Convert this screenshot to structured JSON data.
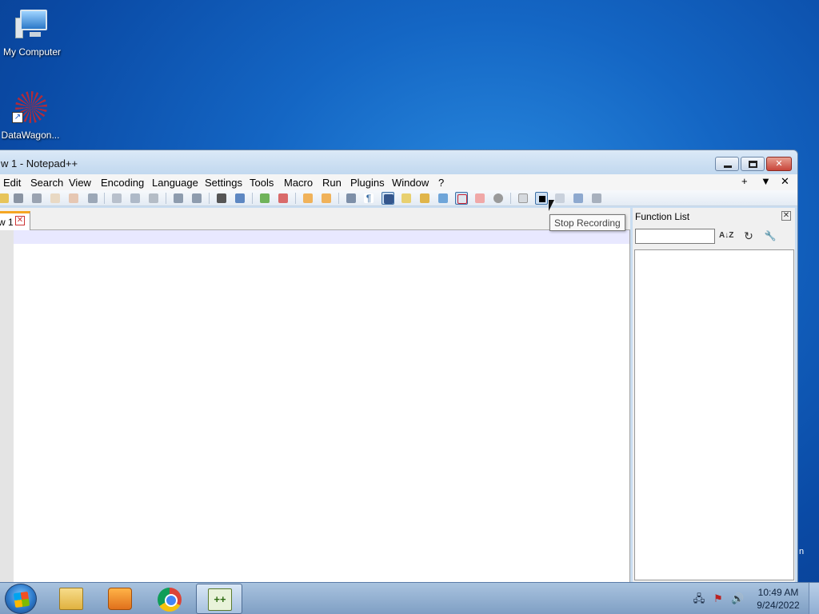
{
  "desktop": {
    "icons": [
      {
        "label": "My Computer",
        "icon": "computer-icon"
      },
      {
        "label": "DataWagon...",
        "icon": "datawagon-icon"
      }
    ]
  },
  "window": {
    "title": "w 1 - Notepad++",
    "menu": [
      "Edit",
      "Search",
      "View",
      "Encoding",
      "Language",
      "Settings",
      "Tools",
      "Macro",
      "Run",
      "Plugins",
      "Window",
      "?"
    ],
    "menu_right": {
      "plus": "+",
      "dropdown": "▼",
      "close": "✕"
    },
    "toolbar_tooltip": "Stop Recording",
    "tab": {
      "name": "w 1",
      "close": "✕"
    }
  },
  "function_list": {
    "title": "Function List",
    "close": "✕",
    "search_value": "",
    "sort_glyph": "A↓Z",
    "reload_glyph": "↻",
    "prefs_glyph": "🔧"
  },
  "taskbar": {
    "apps": [
      "file-explorer-icon",
      "media-player-icon",
      "chrome-icon",
      "notepad-plus-plus-icon"
    ],
    "active_app": "notepad-plus-plus-icon",
    "clock": {
      "time": "10:49 AM",
      "date": "9/24/2022"
    }
  },
  "colors": {
    "desktop_bg": "#1466c4",
    "tab_accent": "#f5a623",
    "current_line": "#e8e8ff"
  }
}
